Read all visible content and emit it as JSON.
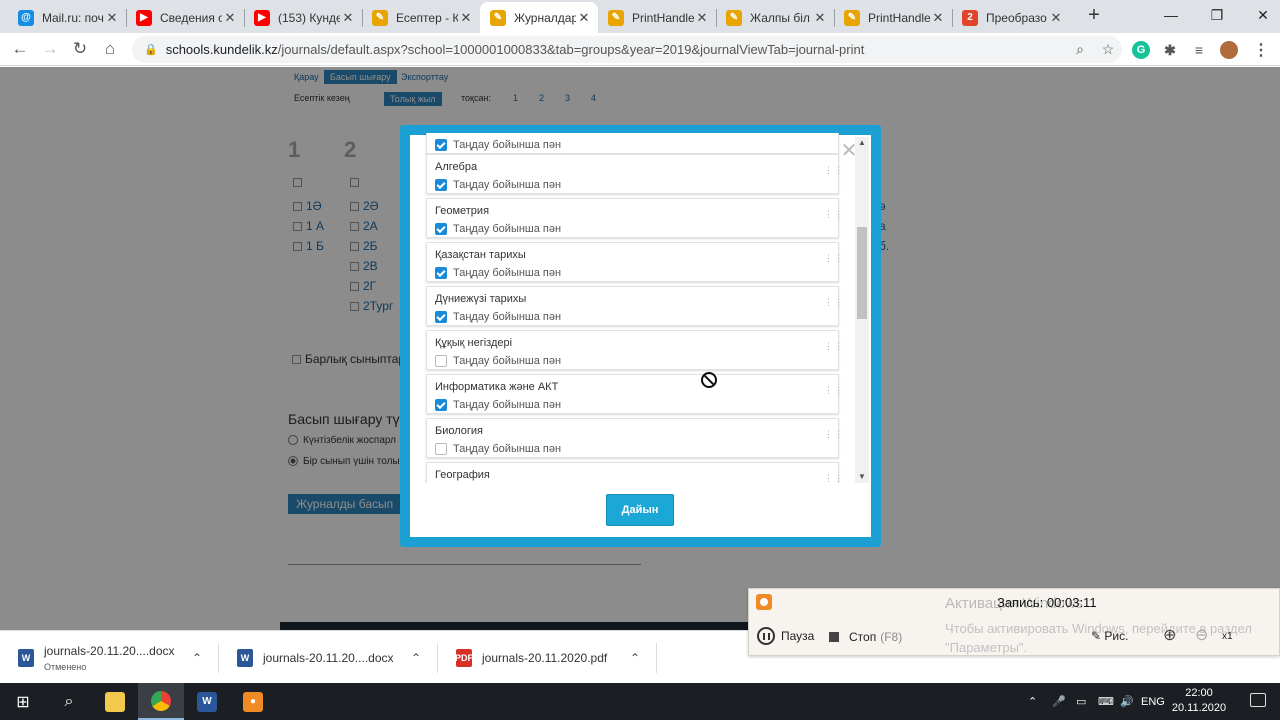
{
  "browser": {
    "tabs": [
      {
        "title": "Mail.ru: поч",
        "icon": "mailru-icon",
        "color": "#168de2",
        "glyph": "@"
      },
      {
        "title": "Сведения о",
        "icon": "youtube-icon",
        "color": "#ff0000",
        "glyph": "▶"
      },
      {
        "title": "(153) Кунде",
        "icon": "youtube-icon",
        "color": "#ff0000",
        "glyph": "▶"
      },
      {
        "title": "Есептер - К",
        "icon": "kundelik-icon",
        "color": "#e8a400",
        "glyph": "✎"
      },
      {
        "title": "Журналдар",
        "icon": "kundelik-icon",
        "color": "#e8a400",
        "glyph": "✎",
        "active": true
      },
      {
        "title": "PrintHandle",
        "icon": "kundelik-icon",
        "color": "#e8a400",
        "glyph": "✎"
      },
      {
        "title": "Жалпы біл",
        "icon": "kundelik-icon",
        "color": "#e8a400",
        "glyph": "✎"
      },
      {
        "title": "PrintHandle",
        "icon": "kundelik-icon",
        "color": "#e8a400",
        "glyph": "✎"
      },
      {
        "title": "Преобразо",
        "icon": "convert-icon",
        "color": "#e0452c",
        "glyph": "2"
      }
    ],
    "url_host": "schools.kundelik.kz",
    "url_path": "/journals/default.aspx?school=1000001000833&tab=groups&year=2019&journalViewTab=journal-print"
  },
  "page_bg": {
    "tabs": {
      "view": "Қарау",
      "print": "Басып шығару",
      "export": "Экспорттау"
    },
    "period_label": "Есептік кезең",
    "full_year": "Толық жыл",
    "quarter_label": "тоқсан:",
    "quarters": [
      "1",
      "2",
      "3",
      "4"
    ],
    "grade_numbers": [
      "1",
      "2"
    ],
    "col1": [
      "1Ә",
      "1 А",
      "1 Б"
    ],
    "col2": [
      "2Ә",
      "2А",
      "2Б",
      "2В",
      "2Г",
      "2Тург"
    ],
    "col3": [
      "ә",
      "а",
      "б."
    ],
    "all_classes": "Барлық сыныптар",
    "print_type": "Басып шығару тү",
    "option_daily": "Күнтізбелік жоспарл",
    "option_one": "Бір сынып үшін толы",
    "print_button": "Журналды басып"
  },
  "modal": {
    "option_label": "Таңдау бойынша пән",
    "partial_top_checked": true,
    "subjects": [
      {
        "name": "Алгебра",
        "checked": true
      },
      {
        "name": "Геометрия",
        "checked": true
      },
      {
        "name": "Қазақстан тарихы",
        "checked": true
      },
      {
        "name": "Дүниежүзі тарихы",
        "checked": true
      },
      {
        "name": "Құқық негіздері",
        "checked": false
      },
      {
        "name": "Информатика және АКТ",
        "checked": true
      },
      {
        "name": "Биология",
        "checked": false
      },
      {
        "name": "География",
        "checked": false
      }
    ],
    "submit_label": "Дайын"
  },
  "downloads": [
    {
      "name": "journals-20.11.20....docx",
      "status": "Отменено",
      "type": "word"
    },
    {
      "name": "journals-20.11.20....docx",
      "status": "",
      "type": "word"
    },
    {
      "name": "journals-20.11.2020.pdf",
      "status": "",
      "type": "pdf"
    }
  ],
  "recorder": {
    "time_label": "Запись:",
    "time_value": "00:03:11",
    "watermark_title": "Активация Windows",
    "watermark_text": "Чтобы активировать Windows, перейдите в раздел \"Параметры\".",
    "pause_label": "Пауза",
    "stop_label": "Стоп",
    "stop_hotkey": "(F8)",
    "draw_label": "Рис.",
    "zoom_label": "x1"
  },
  "taskbar": {
    "language": "ENG",
    "time": "22:00",
    "date": "20.11.2020"
  }
}
